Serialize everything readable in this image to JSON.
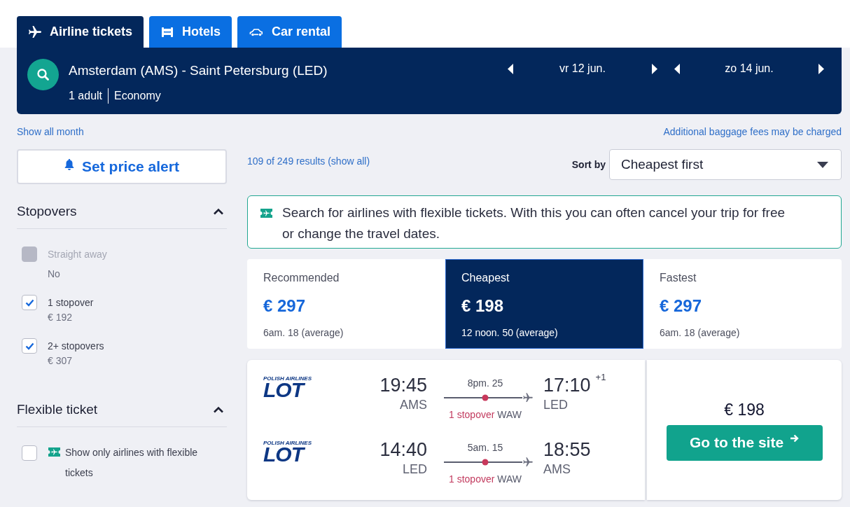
{
  "tabs": [
    {
      "kind": "flight",
      "label": "Airline tickets",
      "selected": true
    },
    {
      "kind": "hotel",
      "label": "Hotels",
      "selected": false
    },
    {
      "kind": "car",
      "label": "Car rental",
      "selected": false
    }
  ],
  "search": {
    "route": "Amsterdam (AMS) - Saint Petersburg (LED)",
    "passengers": "1 adult",
    "cabin": "Economy",
    "dates": [
      "vr 12 jun.",
      "zo 14 jun."
    ]
  },
  "links": {
    "show_all_month": "Show all month",
    "baggage_note": "Additional baggage fees may be charged"
  },
  "sidebar": {
    "price_alert": "Set price alert",
    "filters": [
      {
        "kind": "stopovers",
        "title": "Stopovers",
        "expanded": true,
        "options": [
          {
            "label": "Straight away",
            "detail": "No",
            "checked": false,
            "disabled": true
          },
          {
            "label": "1 stopover",
            "detail": "€ 192",
            "checked": true,
            "disabled": false
          },
          {
            "label": "2+ stopovers",
            "detail": "€ 307",
            "checked": true,
            "disabled": false
          }
        ]
      },
      {
        "kind": "flexible",
        "title": "Flexible ticket",
        "expanded": true,
        "options": [
          {
            "label": "Show only airlines with flexible tickets",
            "checked": false,
            "disabled": false
          }
        ]
      }
    ]
  },
  "results": {
    "count": "109 of 249 results (show all)",
    "sort_label": "Sort by",
    "sort_value": "Cheapest first",
    "notice": "Search for airlines with flexible tickets. With this you can often cancel your trip for free or change the travel dates.",
    "sort_tabs": [
      {
        "label": "Recommended",
        "price": "€ 297",
        "duration": "6am. 18 (average)",
        "selected": false
      },
      {
        "label": "Cheapest",
        "price": "€ 198",
        "duration": "12 noon. 50 (average)",
        "selected": true
      },
      {
        "label": "Fastest",
        "price": "€ 297",
        "duration": "6am. 18 (average)",
        "selected": false
      }
    ],
    "flights": [
      {
        "legs": [
          {
            "airline": {
              "tagline": "POLISH AIRLINES",
              "name": "LOT"
            },
            "depart_time": "19:45",
            "depart_airport": "AMS",
            "duration": "8pm. 25",
            "stops": "1 stopover",
            "via": "WAW",
            "arrive_time": "17:10",
            "day_offset": "+1",
            "arrive_airport": "LED"
          },
          {
            "airline": {
              "tagline": "POLISH AIRLINES",
              "name": "LOT"
            },
            "depart_time": "14:40",
            "depart_airport": "LED",
            "duration": "5am. 15",
            "stops": "1 stopover",
            "via": "WAW",
            "arrive_time": "18:55",
            "arrive_airport": "AMS"
          }
        ],
        "price": "€ 198",
        "button": "Go to the site"
      }
    ]
  }
}
